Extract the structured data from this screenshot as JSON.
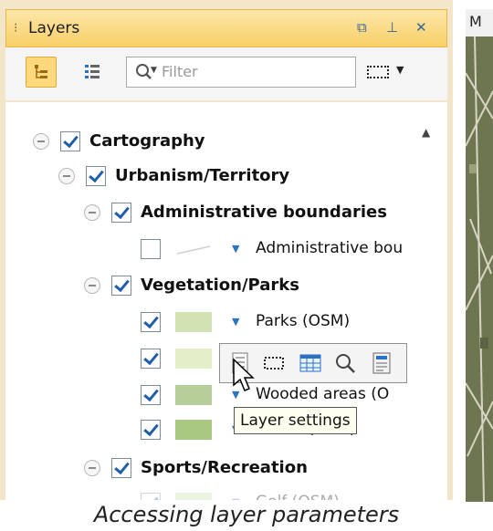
{
  "panel": {
    "title": "Layers",
    "title_icons": [
      "restore-icon",
      "pin-icon",
      "close-icon"
    ],
    "accent_color": "#f7cf66"
  },
  "toolbar": {
    "filter_placeholder": "Filter",
    "buttons": [
      "tree-view-icon",
      "list-view-icon",
      "selection-tool-icon"
    ]
  },
  "tree": {
    "cartography": {
      "label": "Cartography",
      "checked": true
    },
    "urbanism": {
      "label": "Urbanism/Territory",
      "checked": true
    },
    "admin_group": {
      "label": "Administrative boundaries",
      "checked": true
    },
    "admin_layer": {
      "label": "Administrative bou",
      "checked": false
    },
    "vegetation": {
      "label": "Vegetation/Parks",
      "checked": true
    },
    "parks": {
      "label": "Parks (OSM)",
      "checked": true,
      "color": "#d3e2b3"
    },
    "layer2": {
      "label": "",
      "checked": true,
      "color": "#e3edc6"
    },
    "wooded": {
      "label": "Wooded areas (O",
      "checked": true,
      "color": "#b6cf9a"
    },
    "forest": {
      "label": "Forest (OSM)",
      "checked": true,
      "color": "#a9c983"
    },
    "sports": {
      "label": "Sports/Recreation",
      "checked": true
    },
    "golf": {
      "label": "Golf (OSM)",
      "checked": true
    }
  },
  "popup": {
    "icons": [
      "layer-settings-icon",
      "select-icon",
      "attribute-table-icon",
      "zoom-icon",
      "properties-icon"
    ],
    "tooltip": "Layer settings"
  },
  "map": {
    "tab_label": "M"
  },
  "caption": "Accessing layer parameters"
}
